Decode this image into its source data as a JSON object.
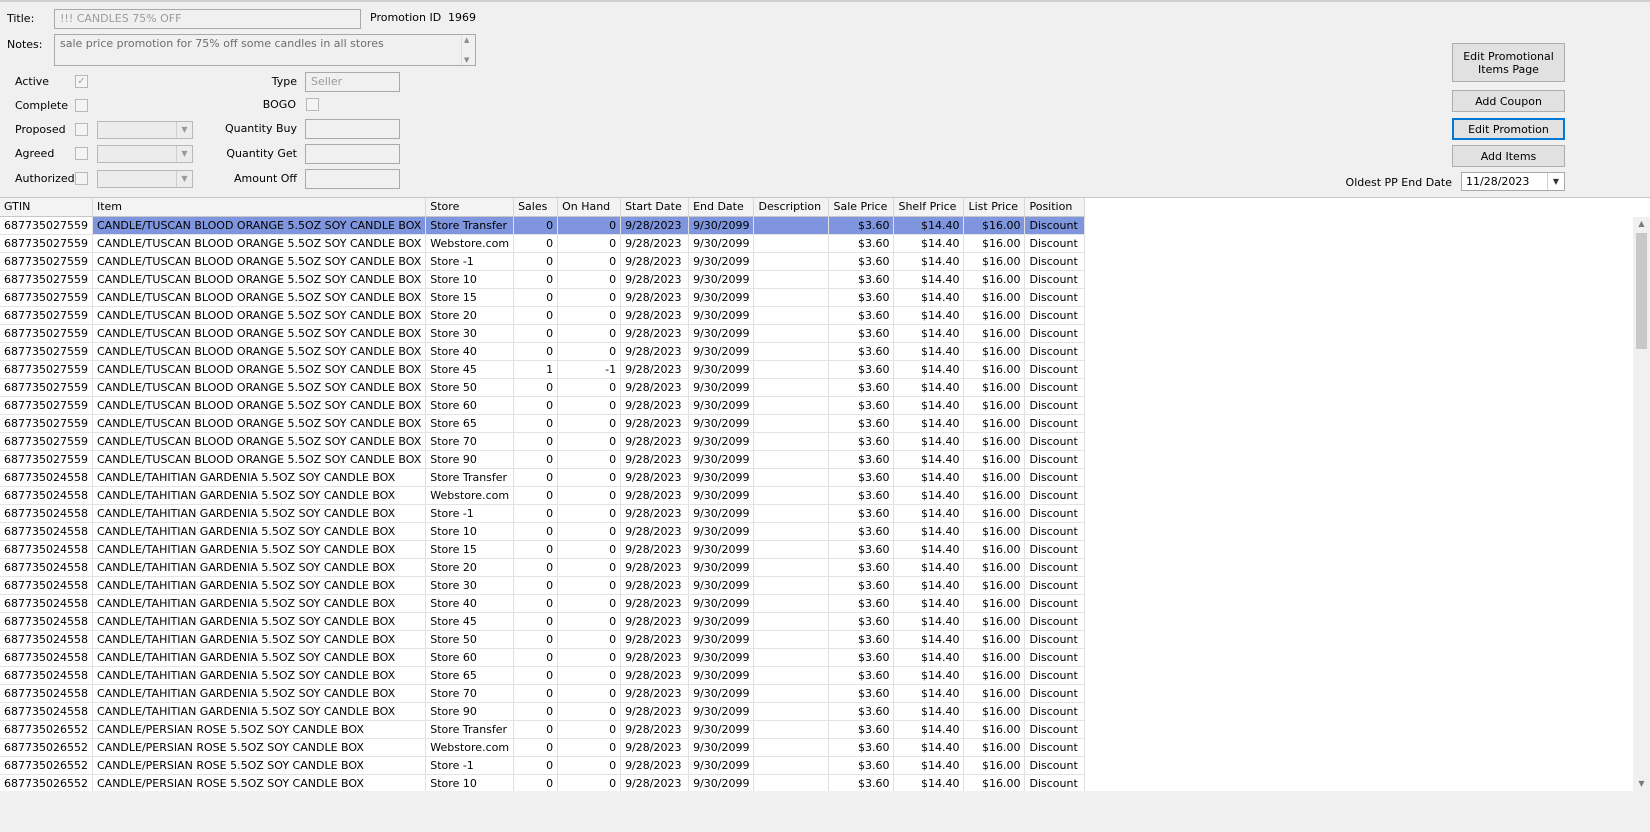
{
  "form": {
    "title_label": "Title:",
    "title_value": "!!! CANDLES 75% OFF",
    "promotion_id_label": "Promotion ID",
    "promotion_id_value": "1969",
    "notes_label": "Notes:",
    "notes_value": "sale price promotion for 75% off some candles in all stores",
    "active_label": "Active",
    "active_checked": true,
    "complete_label": "Complete",
    "proposed_label": "Proposed",
    "agreed_label": "Agreed",
    "authorized_label": "Authorized",
    "type_label": "Type",
    "type_value": "Seller",
    "bogo_label": "BOGO",
    "quantity_buy_label": "Quantity Buy",
    "quantity_get_label": "Quantity Get",
    "amount_off_label": "Amount Off"
  },
  "buttons": {
    "edit_promotional_items_page": "Edit Promotional Items Page",
    "add_coupon": "Add Coupon",
    "edit_promotion": "Edit Promotion",
    "add_items": "Add Items"
  },
  "oldest_pp": {
    "label": "Oldest PP End Date",
    "value": "11/28/2023"
  },
  "icons": [
    "checkmark-icon",
    "dropdown-arrow-icon",
    "scroll-up-icon",
    "scroll-down-icon"
  ],
  "colors": {
    "selected_row": "#7f96df",
    "focused_button_border": "#0078d7"
  },
  "grid": {
    "columns": [
      "GTIN",
      "Item",
      "Store",
      "Sales",
      "On Hand",
      "Start Date",
      "End Date",
      "Description",
      "Sale Price",
      "Shelf Price",
      "List Price",
      "Position"
    ],
    "selected_row": 0,
    "rows": [
      [
        "687735027559",
        "CANDLE/TUSCAN BLOOD ORANGE 5.5OZ SOY CANDLE BOX",
        "Store Transfer",
        "0",
        "0",
        "9/28/2023",
        "9/30/2099",
        "",
        "$3.60",
        "$14.40",
        "$16.00",
        "Discount"
      ],
      [
        "687735027559",
        "CANDLE/TUSCAN BLOOD ORANGE 5.5OZ SOY CANDLE BOX",
        "Webstore.com",
        "0",
        "0",
        "9/28/2023",
        "9/30/2099",
        "",
        "$3.60",
        "$14.40",
        "$16.00",
        "Discount"
      ],
      [
        "687735027559",
        "CANDLE/TUSCAN BLOOD ORANGE 5.5OZ SOY CANDLE BOX",
        "Store -1",
        "0",
        "0",
        "9/28/2023",
        "9/30/2099",
        "",
        "$3.60",
        "$14.40",
        "$16.00",
        "Discount"
      ],
      [
        "687735027559",
        "CANDLE/TUSCAN BLOOD ORANGE 5.5OZ SOY CANDLE BOX",
        "Store 10",
        "0",
        "0",
        "9/28/2023",
        "9/30/2099",
        "",
        "$3.60",
        "$14.40",
        "$16.00",
        "Discount"
      ],
      [
        "687735027559",
        "CANDLE/TUSCAN BLOOD ORANGE 5.5OZ SOY CANDLE BOX",
        "Store 15",
        "0",
        "0",
        "9/28/2023",
        "9/30/2099",
        "",
        "$3.60",
        "$14.40",
        "$16.00",
        "Discount"
      ],
      [
        "687735027559",
        "CANDLE/TUSCAN BLOOD ORANGE 5.5OZ SOY CANDLE BOX",
        "Store 20",
        "0",
        "0",
        "9/28/2023",
        "9/30/2099",
        "",
        "$3.60",
        "$14.40",
        "$16.00",
        "Discount"
      ],
      [
        "687735027559",
        "CANDLE/TUSCAN BLOOD ORANGE 5.5OZ SOY CANDLE BOX",
        "Store 30",
        "0",
        "0",
        "9/28/2023",
        "9/30/2099",
        "",
        "$3.60",
        "$14.40",
        "$16.00",
        "Discount"
      ],
      [
        "687735027559",
        "CANDLE/TUSCAN BLOOD ORANGE 5.5OZ SOY CANDLE BOX",
        "Store 40",
        "0",
        "0",
        "9/28/2023",
        "9/30/2099",
        "",
        "$3.60",
        "$14.40",
        "$16.00",
        "Discount"
      ],
      [
        "687735027559",
        "CANDLE/TUSCAN BLOOD ORANGE 5.5OZ SOY CANDLE BOX",
        "Store 45",
        "1",
        "-1",
        "9/28/2023",
        "9/30/2099",
        "",
        "$3.60",
        "$14.40",
        "$16.00",
        "Discount"
      ],
      [
        "687735027559",
        "CANDLE/TUSCAN BLOOD ORANGE 5.5OZ SOY CANDLE BOX",
        "Store 50",
        "0",
        "0",
        "9/28/2023",
        "9/30/2099",
        "",
        "$3.60",
        "$14.40",
        "$16.00",
        "Discount"
      ],
      [
        "687735027559",
        "CANDLE/TUSCAN BLOOD ORANGE 5.5OZ SOY CANDLE BOX",
        "Store 60",
        "0",
        "0",
        "9/28/2023",
        "9/30/2099",
        "",
        "$3.60",
        "$14.40",
        "$16.00",
        "Discount"
      ],
      [
        "687735027559",
        "CANDLE/TUSCAN BLOOD ORANGE 5.5OZ SOY CANDLE BOX",
        "Store 65",
        "0",
        "0",
        "9/28/2023",
        "9/30/2099",
        "",
        "$3.60",
        "$14.40",
        "$16.00",
        "Discount"
      ],
      [
        "687735027559",
        "CANDLE/TUSCAN BLOOD ORANGE 5.5OZ SOY CANDLE BOX",
        "Store 70",
        "0",
        "0",
        "9/28/2023",
        "9/30/2099",
        "",
        "$3.60",
        "$14.40",
        "$16.00",
        "Discount"
      ],
      [
        "687735027559",
        "CANDLE/TUSCAN BLOOD ORANGE 5.5OZ SOY CANDLE BOX",
        "Store 90",
        "0",
        "0",
        "9/28/2023",
        "9/30/2099",
        "",
        "$3.60",
        "$14.40",
        "$16.00",
        "Discount"
      ],
      [
        "687735024558",
        "CANDLE/TAHITIAN GARDENIA  5.5OZ SOY CANDLE BOX",
        "Store Transfer",
        "0",
        "0",
        "9/28/2023",
        "9/30/2099",
        "",
        "$3.60",
        "$14.40",
        "$16.00",
        "Discount"
      ],
      [
        "687735024558",
        "CANDLE/TAHITIAN GARDENIA  5.5OZ SOY CANDLE BOX",
        "Webstore.com",
        "0",
        "0",
        "9/28/2023",
        "9/30/2099",
        "",
        "$3.60",
        "$14.40",
        "$16.00",
        "Discount"
      ],
      [
        "687735024558",
        "CANDLE/TAHITIAN GARDENIA  5.5OZ SOY CANDLE BOX",
        "Store -1",
        "0",
        "0",
        "9/28/2023",
        "9/30/2099",
        "",
        "$3.60",
        "$14.40",
        "$16.00",
        "Discount"
      ],
      [
        "687735024558",
        "CANDLE/TAHITIAN GARDENIA  5.5OZ SOY CANDLE BOX",
        "Store 10",
        "0",
        "0",
        "9/28/2023",
        "9/30/2099",
        "",
        "$3.60",
        "$14.40",
        "$16.00",
        "Discount"
      ],
      [
        "687735024558",
        "CANDLE/TAHITIAN GARDENIA  5.5OZ SOY CANDLE BOX",
        "Store 15",
        "0",
        "0",
        "9/28/2023",
        "9/30/2099",
        "",
        "$3.60",
        "$14.40",
        "$16.00",
        "Discount"
      ],
      [
        "687735024558",
        "CANDLE/TAHITIAN GARDENIA  5.5OZ SOY CANDLE BOX",
        "Store 20",
        "0",
        "0",
        "9/28/2023",
        "9/30/2099",
        "",
        "$3.60",
        "$14.40",
        "$16.00",
        "Discount"
      ],
      [
        "687735024558",
        "CANDLE/TAHITIAN GARDENIA  5.5OZ SOY CANDLE BOX",
        "Store 30",
        "0",
        "0",
        "9/28/2023",
        "9/30/2099",
        "",
        "$3.60",
        "$14.40",
        "$16.00",
        "Discount"
      ],
      [
        "687735024558",
        "CANDLE/TAHITIAN GARDENIA  5.5OZ SOY CANDLE BOX",
        "Store 40",
        "0",
        "0",
        "9/28/2023",
        "9/30/2099",
        "",
        "$3.60",
        "$14.40",
        "$16.00",
        "Discount"
      ],
      [
        "687735024558",
        "CANDLE/TAHITIAN GARDENIA  5.5OZ SOY CANDLE BOX",
        "Store 45",
        "0",
        "0",
        "9/28/2023",
        "9/30/2099",
        "",
        "$3.60",
        "$14.40",
        "$16.00",
        "Discount"
      ],
      [
        "687735024558",
        "CANDLE/TAHITIAN GARDENIA  5.5OZ SOY CANDLE BOX",
        "Store 50",
        "0",
        "0",
        "9/28/2023",
        "9/30/2099",
        "",
        "$3.60",
        "$14.40",
        "$16.00",
        "Discount"
      ],
      [
        "687735024558",
        "CANDLE/TAHITIAN GARDENIA  5.5OZ SOY CANDLE BOX",
        "Store 60",
        "0",
        "0",
        "9/28/2023",
        "9/30/2099",
        "",
        "$3.60",
        "$14.40",
        "$16.00",
        "Discount"
      ],
      [
        "687735024558",
        "CANDLE/TAHITIAN GARDENIA  5.5OZ SOY CANDLE BOX",
        "Store 65",
        "0",
        "0",
        "9/28/2023",
        "9/30/2099",
        "",
        "$3.60",
        "$14.40",
        "$16.00",
        "Discount"
      ],
      [
        "687735024558",
        "CANDLE/TAHITIAN GARDENIA  5.5OZ SOY CANDLE BOX",
        "Store 70",
        "0",
        "0",
        "9/28/2023",
        "9/30/2099",
        "",
        "$3.60",
        "$14.40",
        "$16.00",
        "Discount"
      ],
      [
        "687735024558",
        "CANDLE/TAHITIAN GARDENIA  5.5OZ SOY CANDLE BOX",
        "Store 90",
        "0",
        "0",
        "9/28/2023",
        "9/30/2099",
        "",
        "$3.60",
        "$14.40",
        "$16.00",
        "Discount"
      ],
      [
        "687735026552",
        "CANDLE/PERSIAN ROSE 5.5OZ SOY CANDLE BOX",
        "Store Transfer",
        "0",
        "0",
        "9/28/2023",
        "9/30/2099",
        "",
        "$3.60",
        "$14.40",
        "$16.00",
        "Discount"
      ],
      [
        "687735026552",
        "CANDLE/PERSIAN ROSE 5.5OZ SOY CANDLE BOX",
        "Webstore.com",
        "0",
        "0",
        "9/28/2023",
        "9/30/2099",
        "",
        "$3.60",
        "$14.40",
        "$16.00",
        "Discount"
      ],
      [
        "687735026552",
        "CANDLE/PERSIAN ROSE 5.5OZ SOY CANDLE BOX",
        "Store -1",
        "0",
        "0",
        "9/28/2023",
        "9/30/2099",
        "",
        "$3.60",
        "$14.40",
        "$16.00",
        "Discount"
      ],
      [
        "687735026552",
        "CANDLE/PERSIAN ROSE 5.5OZ SOY CANDLE BOX",
        "Store 10",
        "0",
        "0",
        "9/28/2023",
        "9/30/2099",
        "",
        "$3.60",
        "$14.40",
        "$16.00",
        "Discount"
      ]
    ]
  }
}
